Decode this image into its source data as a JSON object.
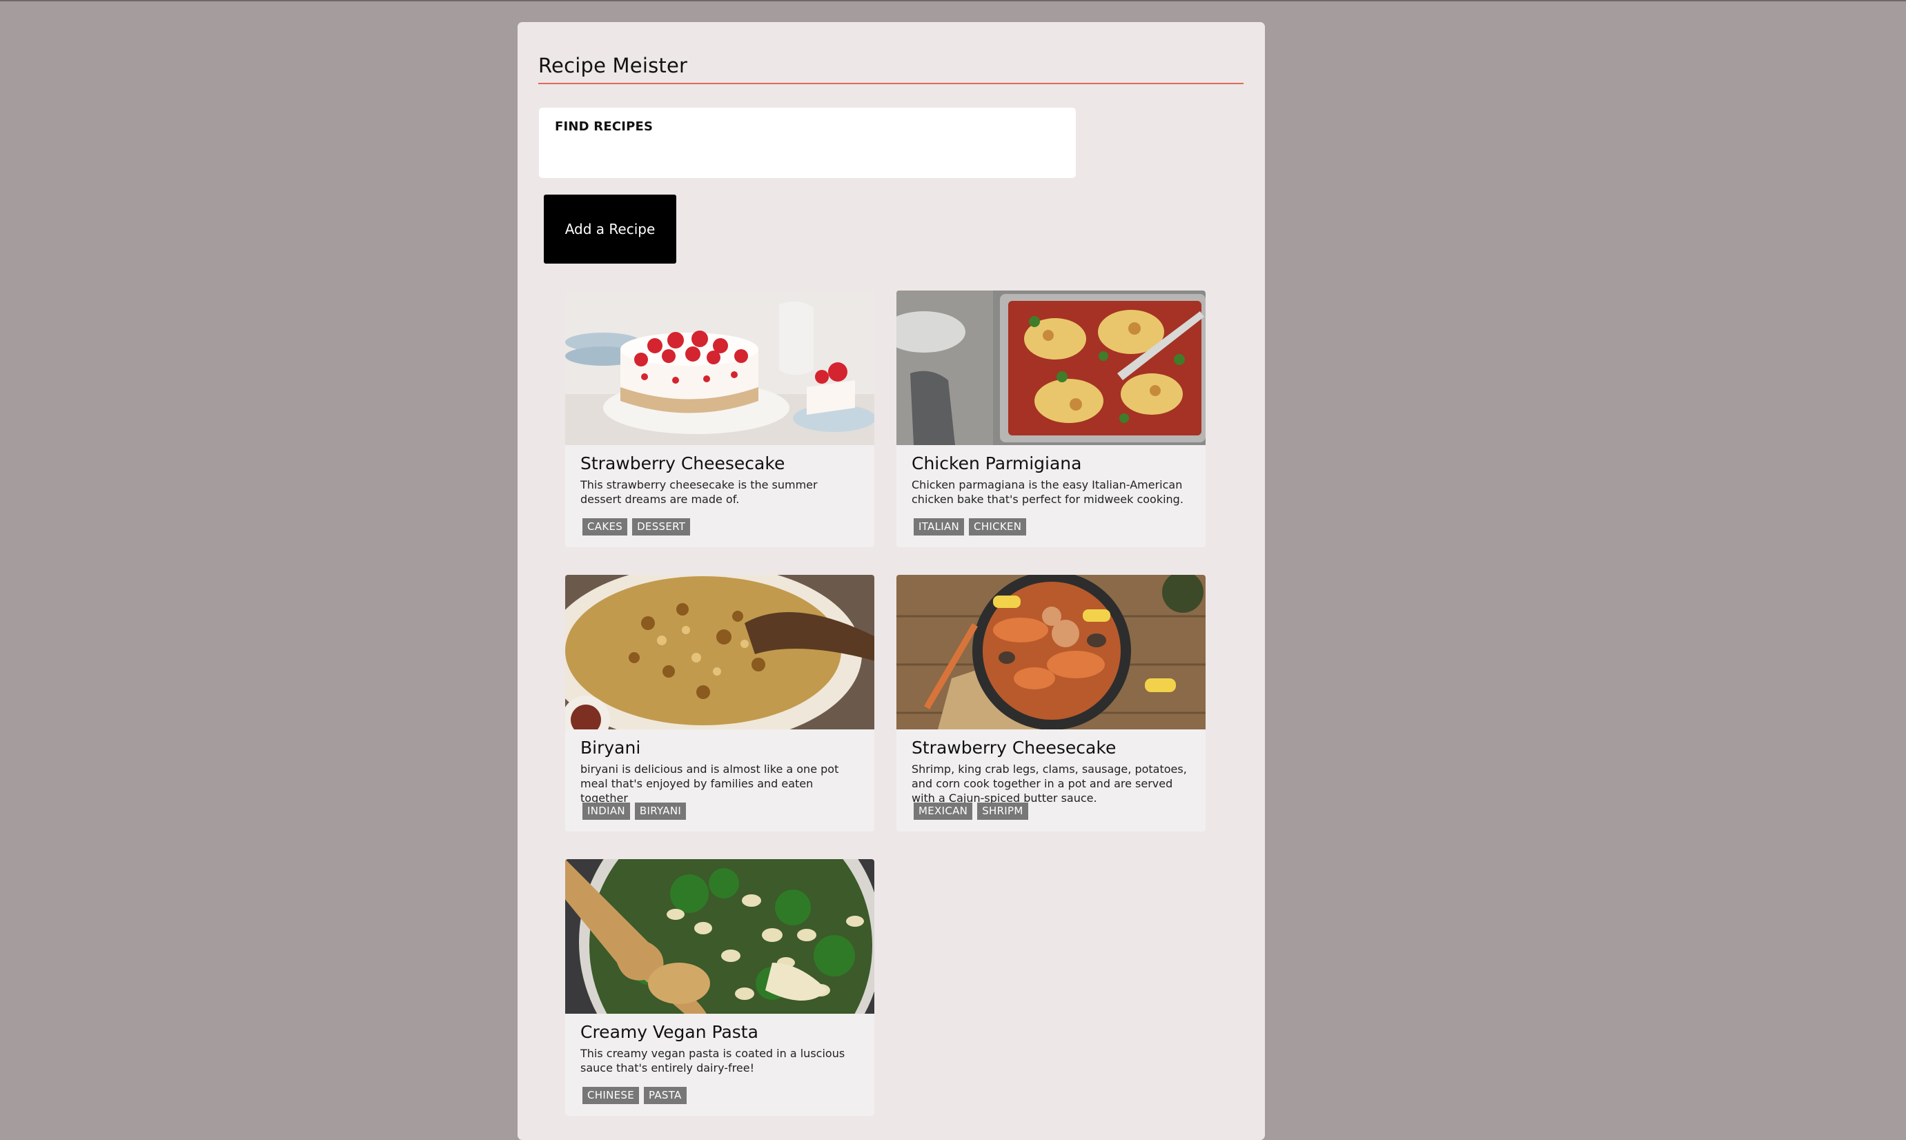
{
  "app": {
    "title": "Recipe Meister"
  },
  "search": {
    "label": "FIND RECIPES",
    "value": ""
  },
  "actions": {
    "add_recipe_label": "Add a Recipe"
  },
  "recipes": [
    {
      "title": "Strawberry Cheesecake",
      "description": "This strawberry cheesecake is the summer dessert dreams are made of.",
      "tags": [
        "CAKES",
        "DESSERT"
      ],
      "image": "cheesecake-photo"
    },
    {
      "title": "Chicken Parmigiana",
      "description": "Chicken parmagiana is the easy Italian-American chicken bake that's perfect for midweek cooking.",
      "tags": [
        "ITALIAN",
        "CHICKEN"
      ],
      "image": "chicken-parmigiana-photo"
    },
    {
      "title": "Biryani",
      "description": "biryani is delicious and is almost like a one pot meal that's enjoyed by families and eaten together",
      "tags": [
        "INDIAN",
        "BIRYANI"
      ],
      "image": "biryani-photo"
    },
    {
      "title": "Strawberry Cheesecake",
      "description": "Shrimp, king crab legs, clams, sausage, potatoes, and corn cook together in a pot and are served with a Cajun-spiced butter sauce.",
      "tags": [
        "MEXICAN",
        "SHRIPM"
      ],
      "image": "seafood-boil-photo"
    },
    {
      "title": "Creamy Vegan Pasta",
      "description": "This creamy vegan pasta is coated in a luscious sauce that's entirely dairy-free!",
      "tags": [
        "CHINESE",
        "PASTA"
      ],
      "image": "vegan-pasta-photo"
    }
  ],
  "colors": {
    "page_background": "#a59d9d",
    "panel_background": "#ede7e7",
    "title_rule": "#e0685c",
    "button": "#000000",
    "tag": "#777777"
  }
}
